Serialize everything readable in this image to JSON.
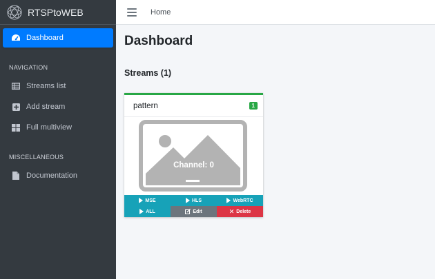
{
  "brand": {
    "name": "RTSPtoWEB",
    "logo_icon": "brand-logo-icon"
  },
  "sidebar": {
    "dashboard": {
      "label": "Dashboard",
      "icon": "tachometer-icon"
    },
    "navigation_header": "NAVIGATION",
    "nav_items": [
      {
        "label": "Streams list",
        "icon": "list-icon"
      },
      {
        "label": "Add stream",
        "icon": "plus-square-icon"
      },
      {
        "label": "Full multiview",
        "icon": "grid-icon"
      }
    ],
    "misc_header": "MISCELLANEOUS",
    "misc_items": [
      {
        "label": "Documentation",
        "icon": "file-icon"
      }
    ]
  },
  "topbar": {
    "menu_icon": "hamburger-icon",
    "home_label": "Home"
  },
  "main": {
    "title": "Dashboard",
    "streams_title": "Streams (1)",
    "stream": {
      "name": "pattern",
      "badge": "1",
      "channel_text": "Channel: 0",
      "buttons": {
        "mse": "MSE",
        "hls": "HLS",
        "webrtc": "WebRTC",
        "all": "ALL",
        "edit": "Edit",
        "delete": "Delete"
      }
    }
  },
  "colors": {
    "sidebar_bg": "#343a40",
    "primary": "#007bff",
    "success": "#28a745",
    "info": "#17a2b8",
    "secondary": "#6c757d",
    "danger": "#dc3545"
  }
}
